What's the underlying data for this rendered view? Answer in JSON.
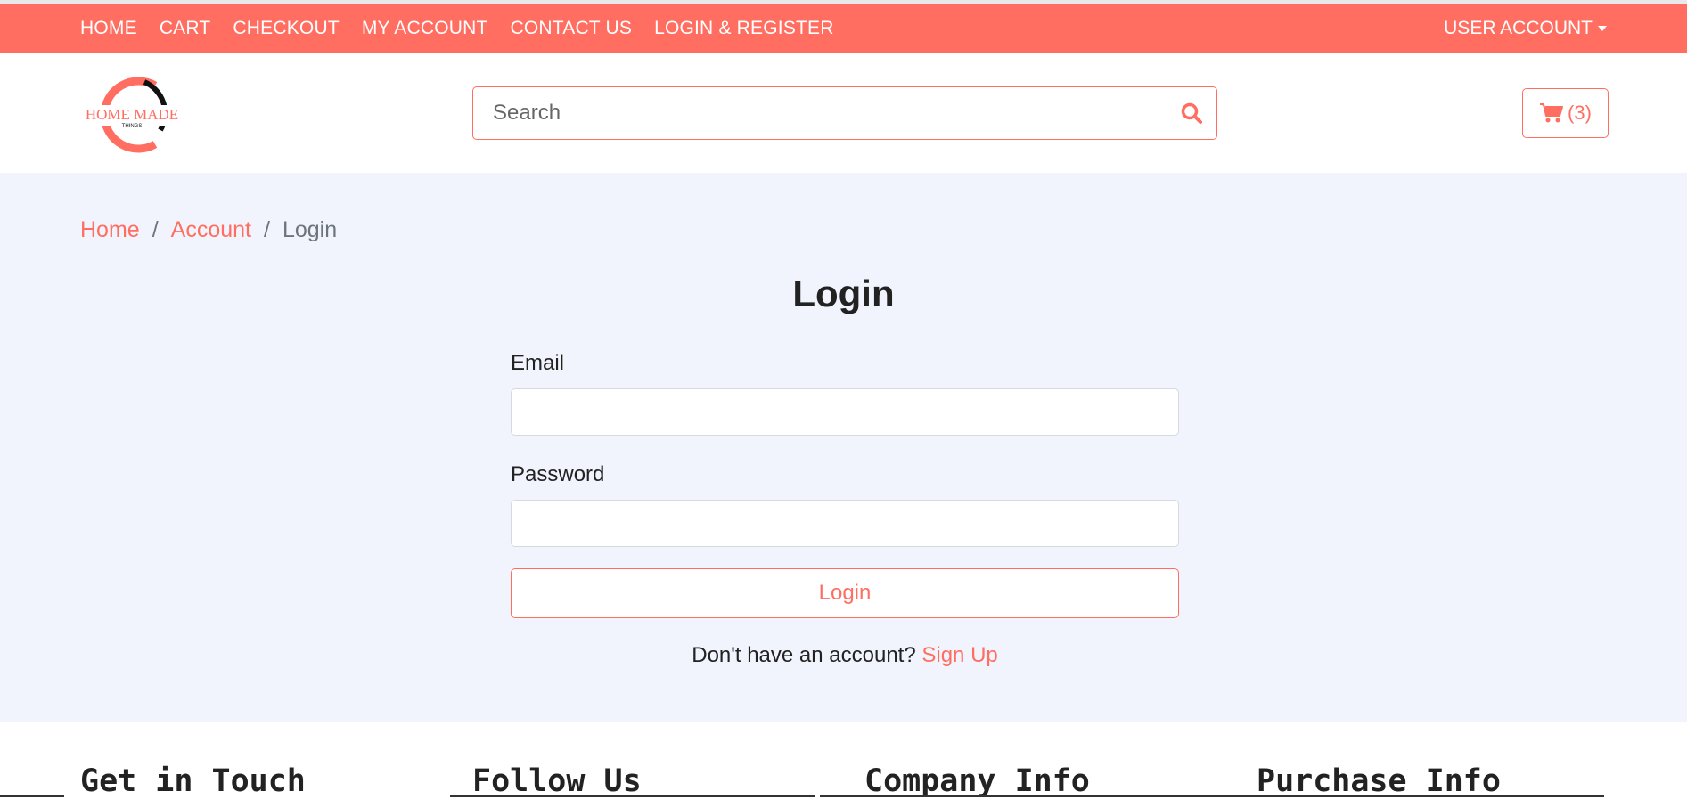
{
  "topnav": {
    "items": [
      "HOME",
      "CART",
      "CHECKOUT",
      "MY ACCOUNT",
      "CONTACT US",
      "LOGIN & REGISTER"
    ],
    "user_account": "USER ACCOUNT"
  },
  "header": {
    "logo": {
      "line1": "HOME MADE",
      "line2": "THINGS"
    },
    "search": {
      "placeholder": "Search",
      "value": ""
    },
    "cart_count": "(3)"
  },
  "breadcrumb": {
    "home": "Home",
    "sep1": "/",
    "account": "Account",
    "sep2": "/",
    "current": "Login"
  },
  "login": {
    "title": "Login",
    "email_label": "Email",
    "email_value": "",
    "password_label": "Password",
    "password_value": "",
    "button": "Login",
    "signup_prompt": "Don't have an account?",
    "signup_link": "Sign Up"
  },
  "footer": {
    "headings": [
      "Get in Touch",
      "Follow Us",
      "Company Info",
      "Purchase Info"
    ]
  },
  "colors": {
    "accent": "#ff6e61",
    "page_bg": "#f1f4fc"
  },
  "icons": {
    "search": "search-icon",
    "cart": "cart-icon",
    "dropdown": "caret-down-icon"
  }
}
